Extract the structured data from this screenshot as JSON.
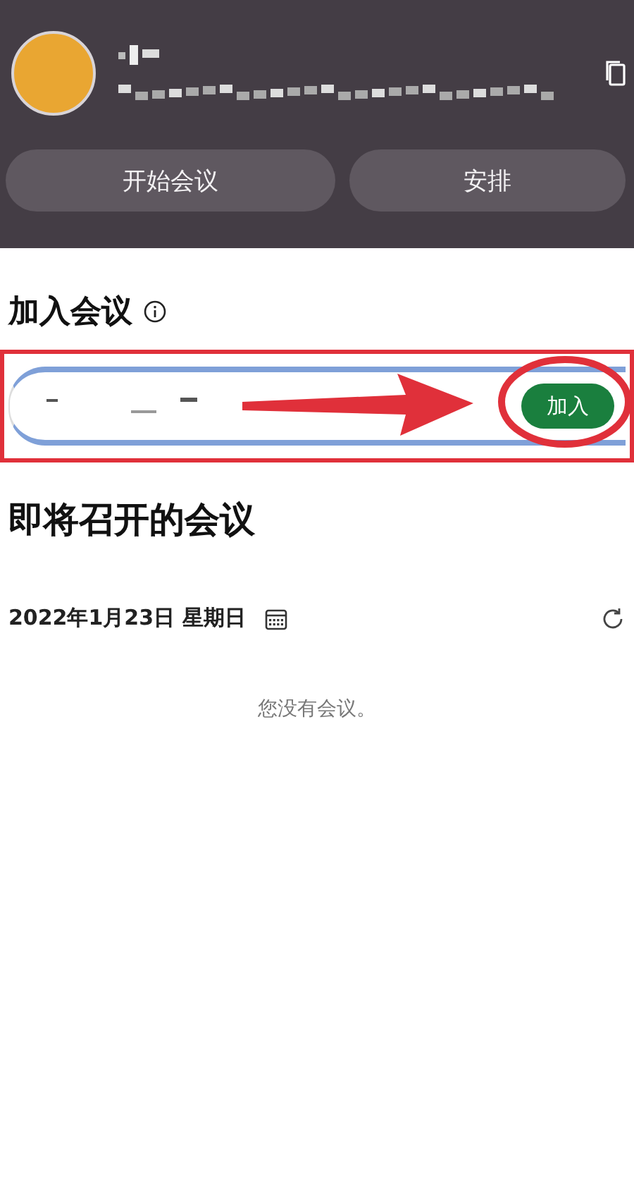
{
  "header": {
    "actions": [
      {
        "label": "开始会议"
      },
      {
        "label": "安排"
      }
    ]
  },
  "join": {
    "title": "加入会议",
    "button": "加入"
  },
  "upcoming": {
    "title": "即将召开的会议",
    "date": "2022年1月23日 星期日",
    "empty": "您没有会议。"
  }
}
